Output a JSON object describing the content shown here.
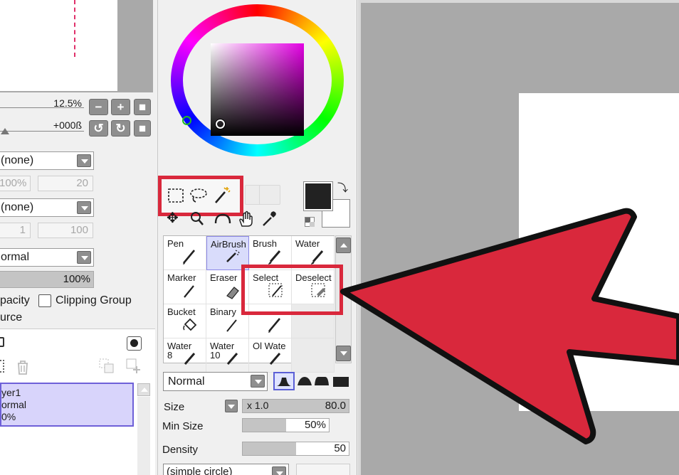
{
  "navigator": {
    "zoom": "12.5%",
    "rotation": "+000ß"
  },
  "layer_props": {
    "texture_combo": "(none)",
    "texture_pct": "100%",
    "texture_val": "20",
    "effect_combo": "(none)",
    "effect_val1": "1",
    "effect_val2": "100",
    "blend_mode": "ormal",
    "opacity_value": "100%",
    "opacity_label": "pacity",
    "opacity_fraction": 1.0,
    "clipping_label": "Clipping Group",
    "source_label": "urce"
  },
  "layers": {
    "items": [
      {
        "name": "yer1",
        "mode": "ormal",
        "opacity": "0%"
      }
    ]
  },
  "colors": {
    "accent_red": "#d9283c",
    "hue_marker": "#22bb22",
    "foreground": "#222222",
    "background": "#ffffff"
  },
  "tool_grid": {
    "cells": [
      {
        "label": "Pen",
        "icon": "pen-icon"
      },
      {
        "label": "AirBrush",
        "icon": "airbrush-icon",
        "selected": true
      },
      {
        "label": "Brush",
        "icon": "brush-icon"
      },
      {
        "label": "Water",
        "icon": "water-brush-icon"
      },
      {
        "label": "Marker",
        "icon": "marker-icon"
      },
      {
        "label": "Eraser",
        "icon": "eraser-icon"
      },
      {
        "label": "Select",
        "icon": "select-brush-icon"
      },
      {
        "label": "Deselect",
        "icon": "deselect-brush-icon"
      },
      {
        "label": "Bucket",
        "icon": "bucket-icon"
      },
      {
        "label": "Binary",
        "icon": "binary-pen-icon"
      },
      {
        "label": "",
        "icon": "pen-icon"
      },
      {
        "label": "",
        "icon": ""
      },
      {
        "label": "Water",
        "sub": "8",
        "icon": "water-icon"
      },
      {
        "label": "Water",
        "sub": "10",
        "icon": "water-icon"
      },
      {
        "label": "Ol Wate",
        "icon": "oil-water-icon"
      },
      {
        "label": "",
        "icon": ""
      }
    ]
  },
  "brush_settings": {
    "blend_mode": "Normal",
    "size_label": "Size",
    "size_multiplier": "x 1.0",
    "size_value": "80.0",
    "size_fraction": 1.0,
    "min_size_label": "Min Size",
    "min_size_value": "50%",
    "min_size_fraction": 0.5,
    "density_label": "Density",
    "density_value": "50",
    "density_fraction": 0.5,
    "shape_combo": "(simple circle)"
  }
}
